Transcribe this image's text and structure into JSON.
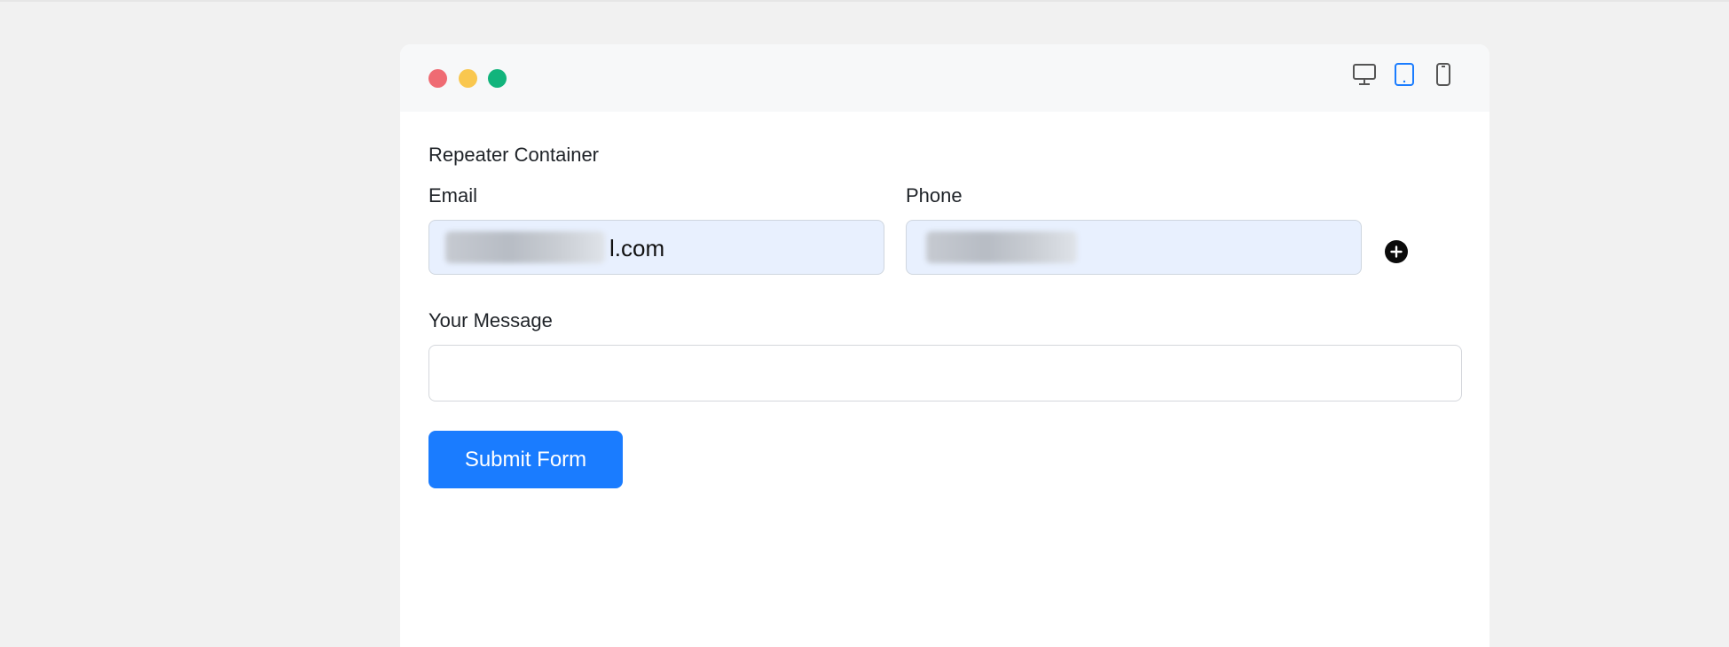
{
  "window": {
    "traffic_lights": [
      "close",
      "minimize",
      "maximize"
    ],
    "device_toggles": [
      {
        "icon": "desktop-icon",
        "active": false
      },
      {
        "icon": "tablet-icon",
        "active": true
      },
      {
        "icon": "mobile-icon",
        "active": false
      }
    ]
  },
  "form": {
    "title": "Repeater Container",
    "email": {
      "label": "Email",
      "value_visible_suffix": "l.com"
    },
    "phone": {
      "label": "Phone",
      "value": ""
    },
    "message": {
      "label": "Your Message",
      "value": ""
    },
    "add_icon": "plus-circle-icon",
    "submit_label": "Submit Form"
  },
  "colors": {
    "accent": "#1a7cff",
    "autofill_bg": "#e8f0fe",
    "close": "#ef6b73",
    "minimize": "#f9c74f",
    "maximize": "#12b47c"
  }
}
